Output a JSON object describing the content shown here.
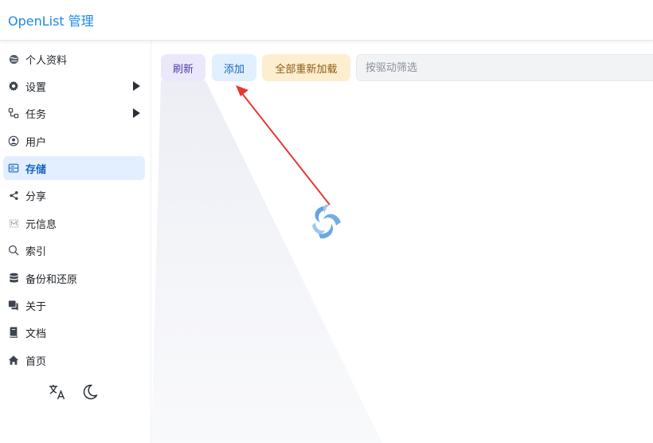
{
  "header": {
    "title": "OpenList 管理"
  },
  "sidebar": {
    "items": [
      {
        "label": "个人资料",
        "icon": "profile-icon"
      },
      {
        "label": "设置",
        "icon": "gear-icon",
        "expandable": true
      },
      {
        "label": "任务",
        "icon": "task-icon",
        "expandable": true
      },
      {
        "label": "用户",
        "icon": "user-icon"
      },
      {
        "label": "存储",
        "icon": "storage-icon",
        "active": true
      },
      {
        "label": "分享",
        "icon": "share-icon"
      },
      {
        "label": "元信息",
        "icon": "meta-icon"
      },
      {
        "label": "索引",
        "icon": "search-icon"
      },
      {
        "label": "备份和还原",
        "icon": "database-icon"
      },
      {
        "label": "关于",
        "icon": "about-icon"
      },
      {
        "label": "文档",
        "icon": "book-icon"
      },
      {
        "label": "首页",
        "icon": "home-icon"
      }
    ],
    "footer": {
      "language_icon": "translate-icon",
      "theme_icon": "moon-icon"
    }
  },
  "toolbar": {
    "refresh_label": "刷新",
    "add_label": "添加",
    "reload_all_label": "全部重新加载",
    "filter_placeholder": "按驱动筛选"
  },
  "colors": {
    "accent": "#1e88e5",
    "active_bg": "#e3efff",
    "refresh_bg": "#ece8fb",
    "add_bg": "#e2efff",
    "reload_bg": "#fdeed0",
    "annotation_arrow": "#e53935"
  }
}
